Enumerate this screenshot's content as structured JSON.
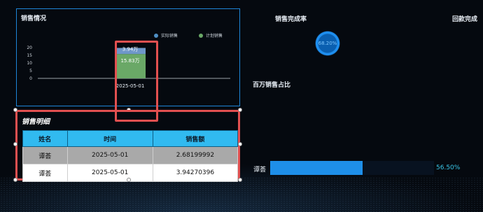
{
  "sales_overview": {
    "title": "销售情况",
    "legend": [
      {
        "label": "实际销售",
        "color": "#4f8fc4"
      },
      {
        "label": "计划销售",
        "color": "#6aa867"
      }
    ]
  },
  "chart_data": {
    "type": "bar",
    "categories": [
      "2025-05-01"
    ],
    "series": [
      {
        "name": "实际销售",
        "values": [
          3.94
        ],
        "data_label": "3.94万",
        "color": "#6e97c9"
      },
      {
        "name": "计划销售",
        "values": [
          15.83
        ],
        "data_label": "15.83万",
        "color": "#6aa867"
      }
    ],
    "stacked": true,
    "y_ticks": [
      "20",
      "15",
      "10",
      "5",
      "0"
    ],
    "ylim": [
      0,
      20
    ]
  },
  "sales_detail": {
    "title": "销售明细",
    "columns": [
      "姓名",
      "时间",
      "销售额"
    ],
    "rows": [
      [
        "谭荟",
        "2025-05-01",
        "2.68199992"
      ],
      [
        "谭荟",
        "2025-05-01",
        "3.94270396"
      ]
    ]
  },
  "completion": {
    "title": "销售完成率",
    "value": "68.20%",
    "fraction": 0.682,
    "color": "#1e8ff0"
  },
  "collection": {
    "title": "回款完成"
  },
  "share": {
    "title": "百万销售占比",
    "name": "谭荟",
    "percent_label": "56.50%",
    "fraction": 0.565,
    "color": "#1e8fe9"
  }
}
